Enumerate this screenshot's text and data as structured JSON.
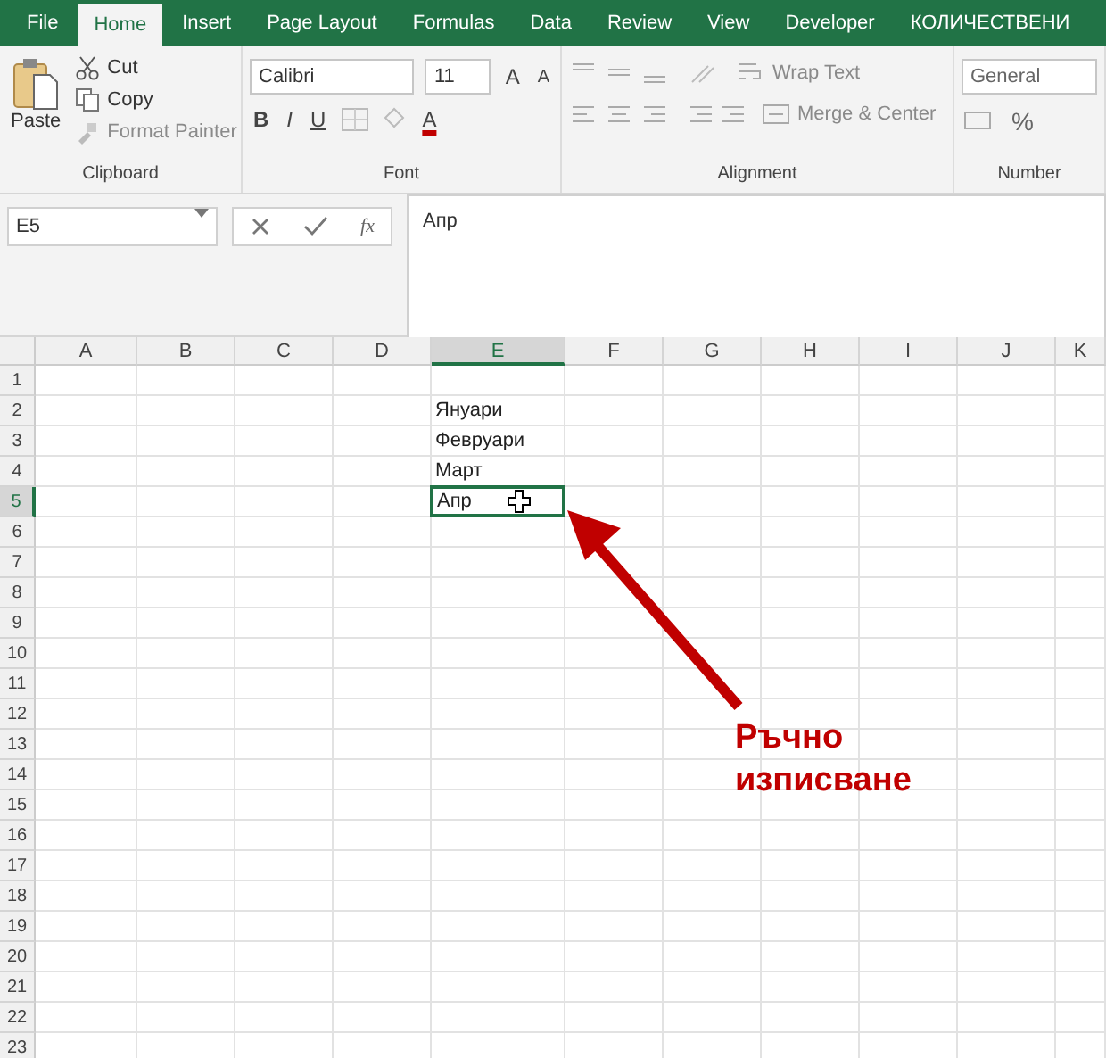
{
  "tabs": [
    {
      "label": "File",
      "selected": false
    },
    {
      "label": "Home",
      "selected": true
    },
    {
      "label": "Insert",
      "selected": false
    },
    {
      "label": "Page Layout",
      "selected": false
    },
    {
      "label": "Formulas",
      "selected": false
    },
    {
      "label": "Data",
      "selected": false
    },
    {
      "label": "Review",
      "selected": false
    },
    {
      "label": "View",
      "selected": false
    },
    {
      "label": "Developer",
      "selected": false
    },
    {
      "label": "КОЛИЧЕСТВЕНИ",
      "selected": false
    }
  ],
  "clipboard": {
    "paste": "Paste",
    "cut": "Cut",
    "copy": "Copy",
    "format_painter": "Format Painter",
    "label": "Clipboard"
  },
  "font": {
    "name": "Calibri",
    "size": "11",
    "grow": "A",
    "shrink": "A",
    "bold": "B",
    "italic": "I",
    "underline": "U",
    "font_color": "A",
    "label": "Font"
  },
  "alignment": {
    "wrap_text": "Wrap Text",
    "merge_center": "Merge & Center",
    "label": "Alignment"
  },
  "number": {
    "format": "General",
    "percent": "%",
    "label": "Number"
  },
  "formula_bar": {
    "name_box": "E5",
    "function_glyph": "fx",
    "value": "Апр"
  },
  "columns": [
    {
      "label": "A",
      "selected": false
    },
    {
      "label": "B",
      "selected": false
    },
    {
      "label": "C",
      "selected": false
    },
    {
      "label": "D",
      "selected": false
    },
    {
      "label": "E",
      "selected": true
    },
    {
      "label": "F",
      "selected": false
    },
    {
      "label": "G",
      "selected": false
    },
    {
      "label": "H",
      "selected": false
    },
    {
      "label": "I",
      "selected": false
    },
    {
      "label": "J",
      "selected": false
    },
    {
      "label": "K",
      "selected": false
    }
  ],
  "rows": [
    {
      "number": "1",
      "selected": false
    },
    {
      "number": "2",
      "selected": false,
      "column_e": "Януари"
    },
    {
      "number": "3",
      "selected": false,
      "column_e": "Февруари"
    },
    {
      "number": "4",
      "selected": false,
      "column_e": "Март"
    },
    {
      "number": "5",
      "selected": true,
      "column_e": "Апр"
    },
    {
      "number": "6",
      "selected": false
    },
    {
      "number": "7",
      "selected": false
    },
    {
      "number": "8",
      "selected": false
    },
    {
      "number": "9",
      "selected": false
    },
    {
      "number": "10",
      "selected": false
    },
    {
      "number": "11",
      "selected": false
    },
    {
      "number": "12",
      "selected": false
    },
    {
      "number": "13",
      "selected": false
    },
    {
      "number": "14",
      "selected": false
    },
    {
      "number": "15",
      "selected": false
    },
    {
      "number": "16",
      "selected": false
    },
    {
      "number": "17",
      "selected": false
    },
    {
      "number": "18",
      "selected": false
    },
    {
      "number": "19",
      "selected": false
    },
    {
      "number": "20",
      "selected": false
    },
    {
      "number": "21",
      "selected": false
    },
    {
      "number": "22",
      "selected": false
    },
    {
      "number": "23",
      "selected": false
    }
  ],
  "annotation": {
    "text": "Ръчно изписване"
  }
}
